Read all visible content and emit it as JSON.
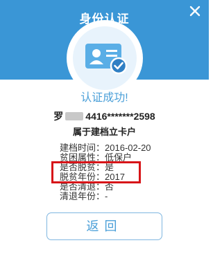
{
  "dialog": {
    "title": "身份认证",
    "close_icon": "close-icon",
    "hero_icon": "id-card-check-icon"
  },
  "result": {
    "status": "认证成功!",
    "name_surname": "罗",
    "id_number": "4416*******2598",
    "category": "属于建档立卡户"
  },
  "details": [
    {
      "label": "建档时间",
      "value": "2016-02-20"
    },
    {
      "label": "贫困属性",
      "value": "低保户"
    },
    {
      "label": "是否脱贫",
      "value": "是"
    },
    {
      "label": "脱贫年份",
      "value": "2017"
    },
    {
      "label": "是否清退",
      "value": "否"
    },
    {
      "label": "清退年份",
      "value": "-"
    }
  ],
  "actions": {
    "back_label": "返回"
  },
  "colors": {
    "header": "#3a96d6",
    "accent": "#4a9fd8",
    "highlight": "#d71418"
  }
}
